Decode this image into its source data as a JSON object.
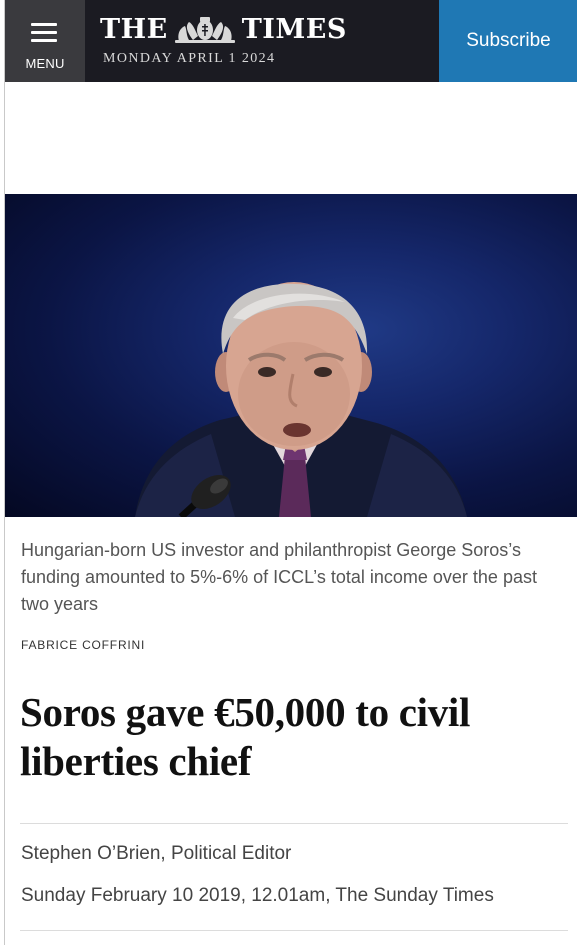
{
  "header": {
    "menu_label": "MENU",
    "masthead_left": "THE",
    "masthead_right": "TIMES",
    "date": "MONDAY APRIL 1 2024",
    "subscribe_label": "Subscribe"
  },
  "photo": {
    "caption": "Hungarian-born US investor and philanthropist George Soros’s funding amounted to 5%-6% of ICCL’s total income over the past two years",
    "credit": "FABRICE COFFRINI"
  },
  "article": {
    "headline": "Soros gave €50,000 to civil liberties chief",
    "byline": "Stephen O’Brien, Political Editor",
    "dateline": "Sunday February 10 2019, 12.01am, The Sunday Times"
  },
  "colors": {
    "header_bg": "#1b1b22",
    "menu_bg": "#3a3a3e",
    "subscribe_bg": "#1f78b4",
    "photo_bg": "#0b1545"
  },
  "icons": {
    "menu": "hamburger-icon",
    "crest": "royal-crest-icon",
    "microphone": "microphone"
  }
}
